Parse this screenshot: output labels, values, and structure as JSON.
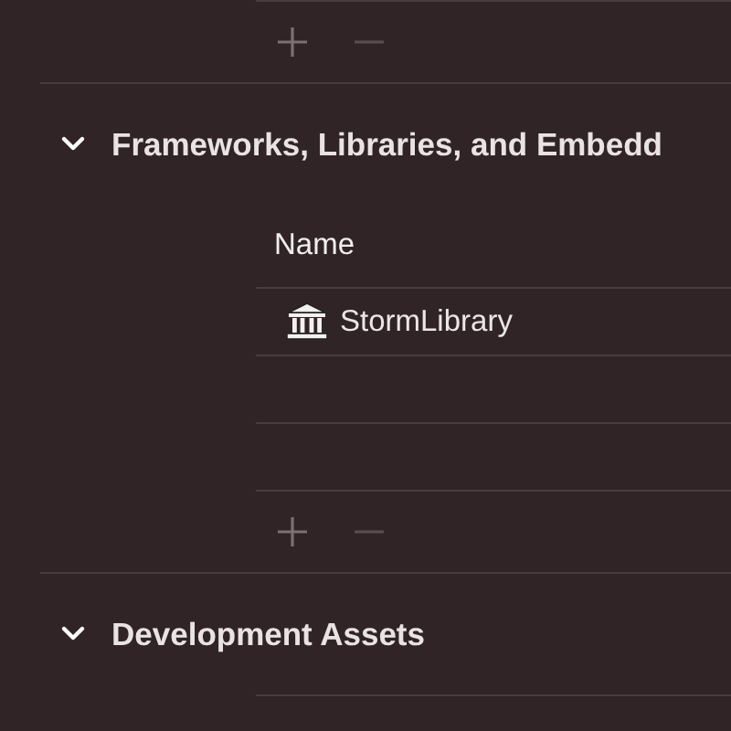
{
  "previous_section": {
    "controls": [
      {
        "kind": "add",
        "disabled": false
      },
      {
        "kind": "remove",
        "disabled": true
      }
    ]
  },
  "sections": [
    {
      "title": "Frameworks, Libraries, and Embedd",
      "expanded": true,
      "table": {
        "columns": [
          "Name"
        ],
        "rows": [
          {
            "name": "StormLibrary",
            "kind": "library"
          }
        ]
      },
      "controls": [
        {
          "kind": "add",
          "disabled": false
        },
        {
          "kind": "remove",
          "disabled": true
        }
      ]
    },
    {
      "title": "Development Assets",
      "expanded": true
    }
  ]
}
